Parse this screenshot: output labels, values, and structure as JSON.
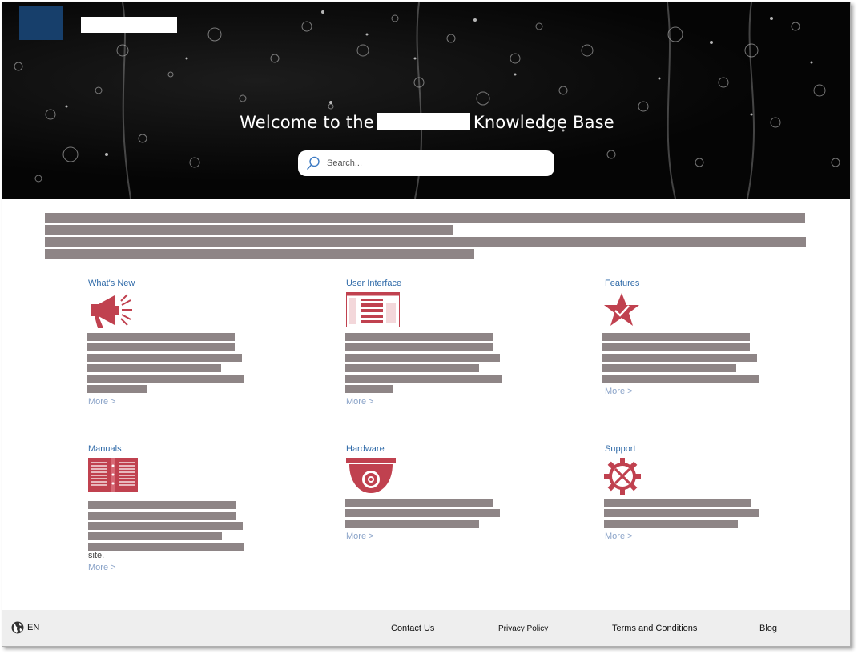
{
  "header": {
    "title_prefix": "Welcome to the",
    "title_suffix": "Knowledge Base",
    "search_placeholder": "Search..."
  },
  "categories": [
    {
      "title": "What's New",
      "more": "More >",
      "icon": "megaphone-icon"
    },
    {
      "title": "User Interface",
      "more": "More >",
      "icon": "ui-screen-icon"
    },
    {
      "title": "Features",
      "more": "More >",
      "icon": "star-check-icon"
    },
    {
      "title": "Manuals",
      "more": "More >",
      "icon": "open-book-icon",
      "tail": "site."
    },
    {
      "title": "Hardware",
      "more": "More >",
      "icon": "dome-camera-icon"
    },
    {
      "title": "Support",
      "more": "More >",
      "icon": "gear-tools-icon"
    }
  ],
  "footer": {
    "language": "EN",
    "contact": "Contact Us",
    "privacy": "Privacy Policy",
    "terms": "Terms and Conditions",
    "blog": "Blog"
  },
  "colors": {
    "accent_red": "#c0414f",
    "link_blue": "#2f6aa8",
    "logo_blue": "#173f6b",
    "redaction_gray": "#8e8586"
  }
}
